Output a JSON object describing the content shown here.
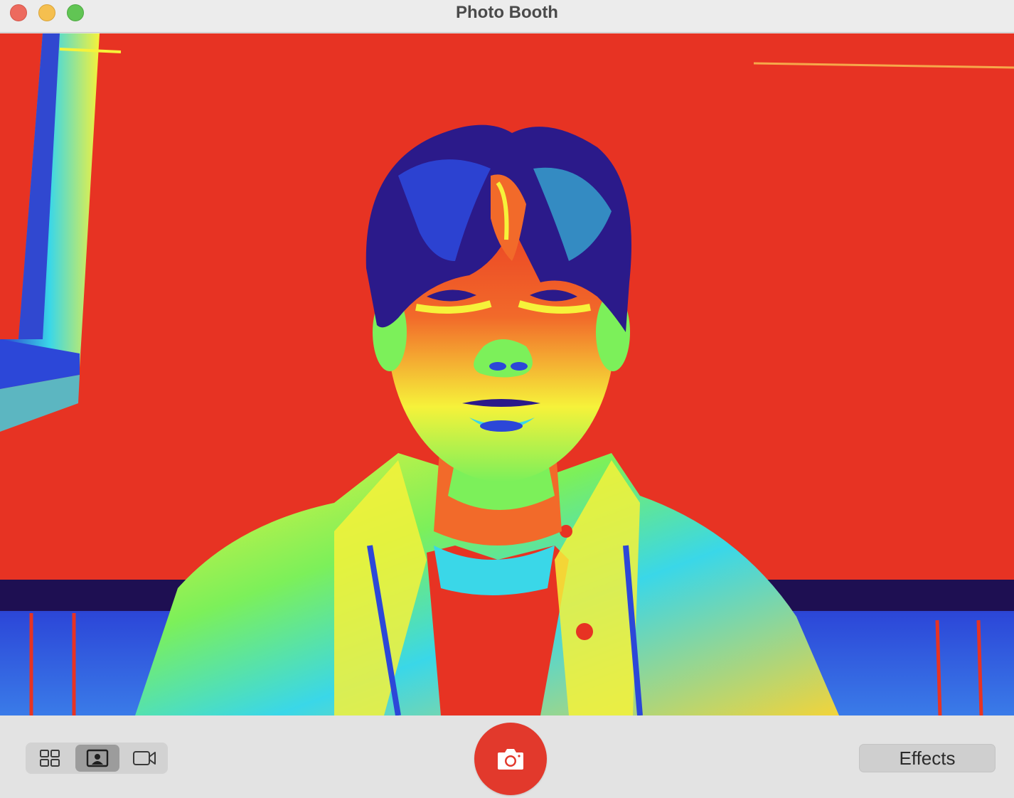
{
  "window": {
    "title": "Photo Booth",
    "controls": [
      "close-icon",
      "minimize-icon",
      "zoom-icon"
    ]
  },
  "preview": {
    "effect": "thermal-camera",
    "colors": {
      "background": "#e73323",
      "hair": "#2b1a8a",
      "skin_highlight": "#f6f23a",
      "cyan": "#3ad7e8",
      "green": "#7cf05a",
      "blue": "#2c47d8"
    }
  },
  "toolbar": {
    "view_modes": [
      {
        "name": "grid-icon",
        "selected": false
      },
      {
        "name": "photo-portrait-icon",
        "selected": true
      },
      {
        "name": "video-camera-icon",
        "selected": false
      }
    ],
    "shutter_icon": "camera-icon",
    "effects_label": "Effects",
    "colors": {
      "shutter": "#e2392c",
      "selected_mode": "#9c9c9c"
    }
  }
}
